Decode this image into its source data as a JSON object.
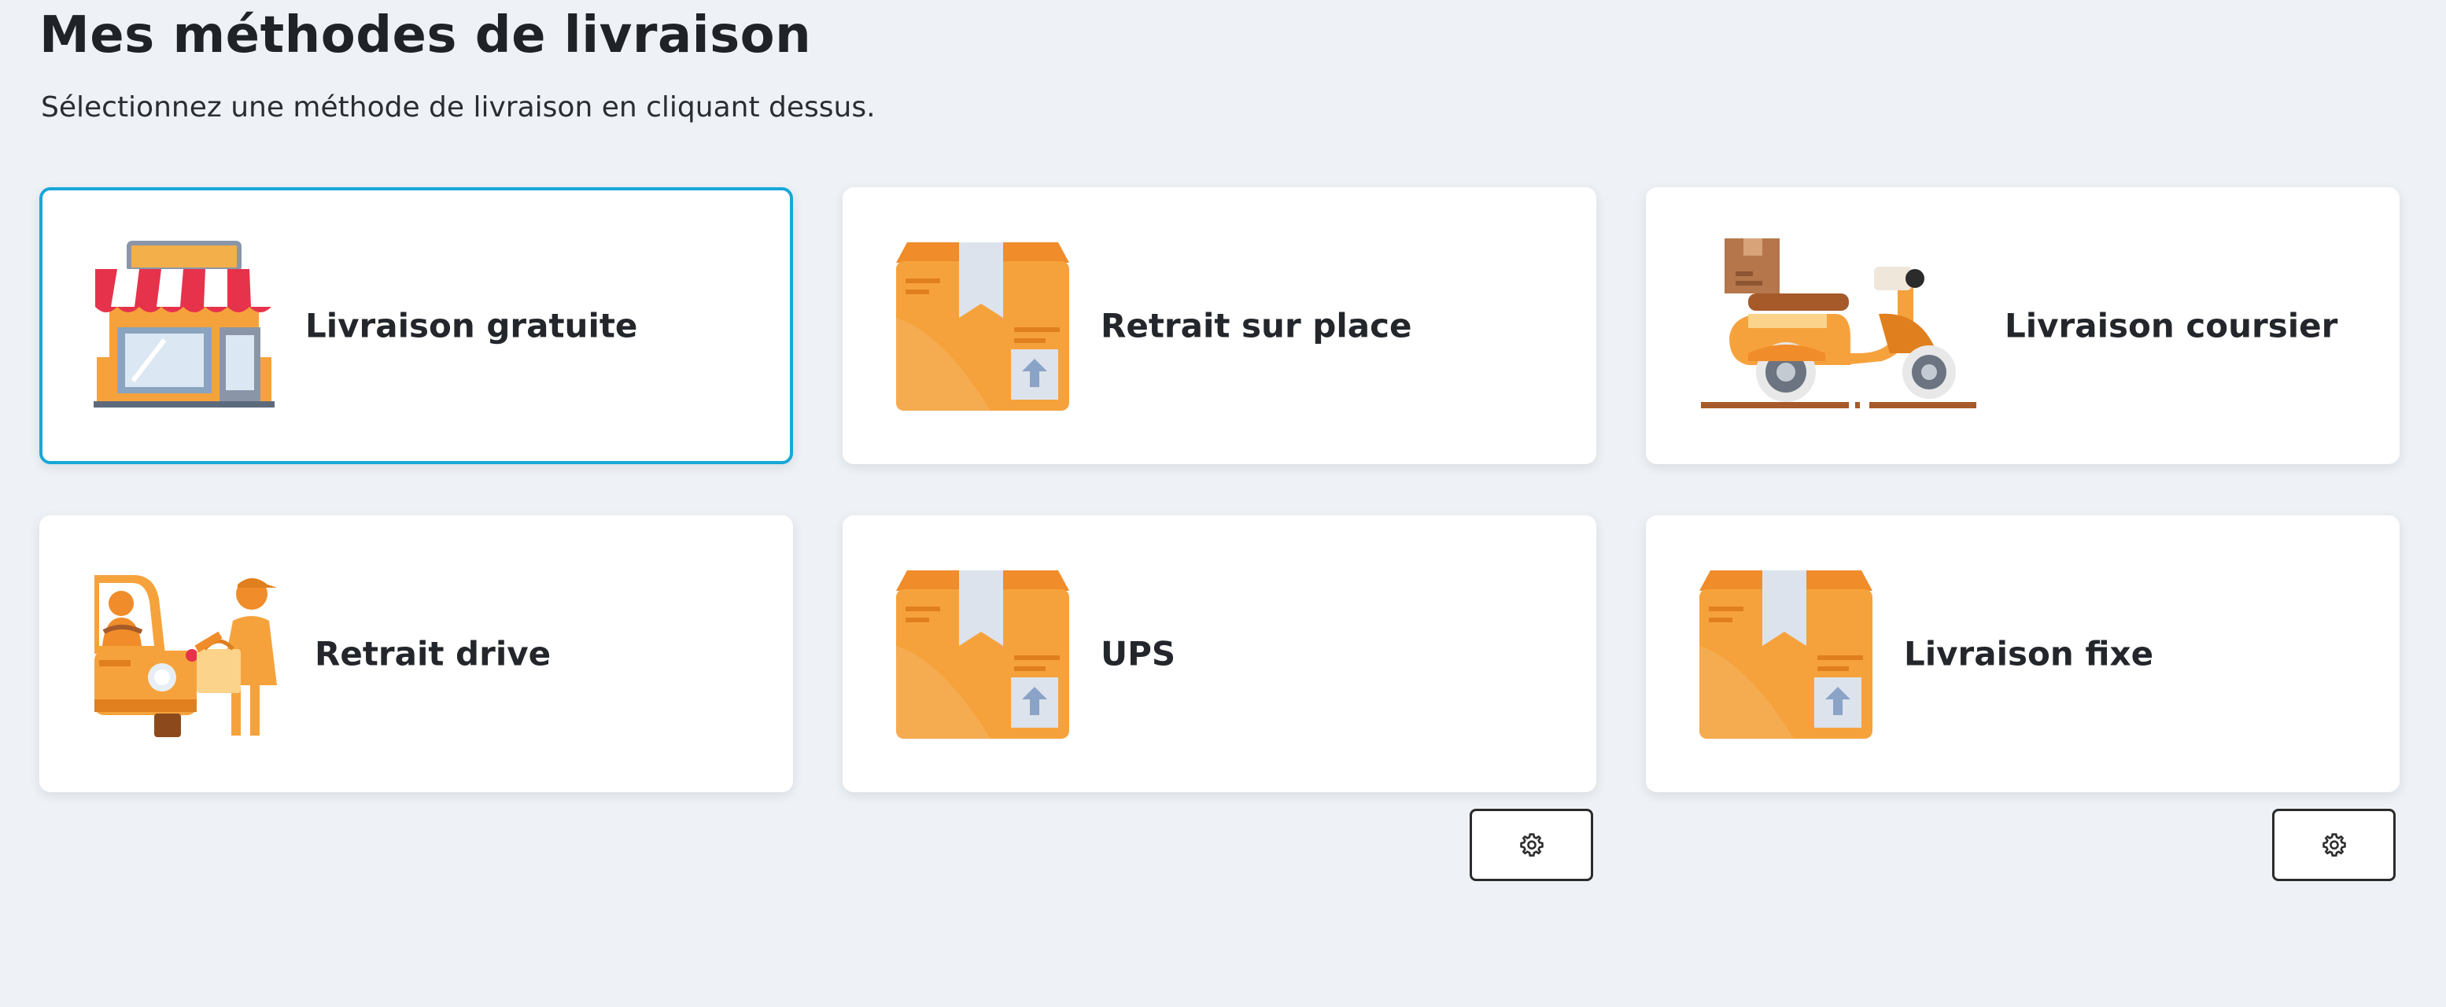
{
  "header": {
    "title": "Mes méthodes de livraison",
    "subtitle": "Sélectionnez une méthode de livraison en cliquant dessus."
  },
  "methods": [
    {
      "label": "Livraison gratuite",
      "icon": "storefront-icon",
      "selected": true
    },
    {
      "label": "Retrait sur place",
      "icon": "package-box-icon",
      "selected": false
    },
    {
      "label": "Livraison coursier",
      "icon": "scooter-icon",
      "selected": false
    },
    {
      "label": "Retrait drive",
      "icon": "drive-pickup-icon",
      "selected": false
    },
    {
      "label": "UPS",
      "icon": "package-box-icon",
      "selected": false
    },
    {
      "label": "Livraison fixe",
      "icon": "package-box-icon",
      "selected": false
    }
  ],
  "settings_buttons": [
    {
      "for": "UPS",
      "icon": "gear-icon"
    },
    {
      "for": "Livraison fixe",
      "icon": "gear-icon"
    }
  ],
  "colors": {
    "background": "#eef2f6",
    "selected_border": "#17a8d8",
    "illustration_orange": "#f6a23c"
  }
}
